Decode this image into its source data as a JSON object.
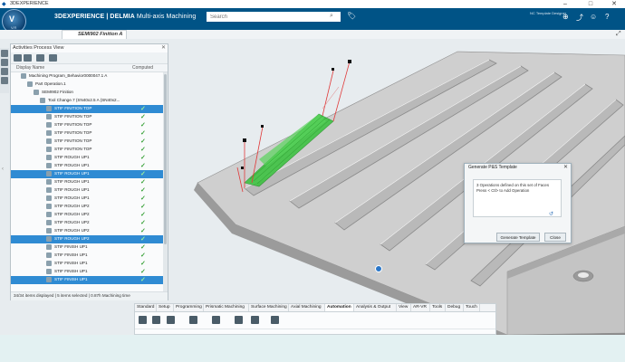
{
  "window": {
    "title": "3DEXPERIENCE",
    "controls": [
      "–",
      "□",
      "✕"
    ]
  },
  "header": {
    "brand_prefix": "3D",
    "brand_main": "EXPERIENCE | DELMIA",
    "app_name": " Multi-axis Machining",
    "search_placeholder": "Search",
    "user": "NC Template Designer",
    "compass_version": "V.R",
    "icons": [
      "tag-icon",
      "add-icon",
      "share-icon",
      "person-icon",
      "help-icon"
    ]
  },
  "document_tab": {
    "label": "SEMI902 Finition A"
  },
  "panel": {
    "title": "Activities Process View",
    "close": "✕",
    "columns": {
      "name": "Display Name",
      "computed": "Computed"
    },
    "status": "34/34 items displayed | 5 items selected | 0.87h Machining time",
    "rows": [
      {
        "label": "Machining Program_Behavior0000047.1 A",
        "indent": 1,
        "selected": false,
        "computed": false
      },
      {
        "label": "Part Operation.1",
        "indent": 2,
        "selected": false,
        "computed": false
      },
      {
        "label": "SEMI902 Finition",
        "indent": 3,
        "selected": false,
        "computed": false
      },
      {
        "label": "Tool Change.7 (SN40x2.5 A (SN40x2...",
        "indent": 4,
        "selected": false,
        "computed": false
      },
      {
        "label": "STIF FINITION TOP",
        "indent": 5,
        "selected": true,
        "computed": true
      },
      {
        "label": "STIF FINITION TOP",
        "indent": 5,
        "selected": false,
        "computed": true
      },
      {
        "label": "STIF FINITION TOP",
        "indent": 5,
        "selected": false,
        "computed": true
      },
      {
        "label": "STIF FINITION TOP",
        "indent": 5,
        "selected": false,
        "computed": true
      },
      {
        "label": "STIF FINITION TOP",
        "indent": 5,
        "selected": false,
        "computed": true
      },
      {
        "label": "STIF FINITION TOP",
        "indent": 5,
        "selected": false,
        "computed": true
      },
      {
        "label": "STIF ROUGH UP1",
        "indent": 5,
        "selected": false,
        "computed": true
      },
      {
        "label": "STIF ROUGH UP1",
        "indent": 5,
        "selected": false,
        "computed": true
      },
      {
        "label": "STIF ROUGH UP1",
        "indent": 5,
        "selected": true,
        "computed": true
      },
      {
        "label": "STIF ROUGH UP1",
        "indent": 5,
        "selected": false,
        "computed": true
      },
      {
        "label": "STIF ROUGH UP1",
        "indent": 5,
        "selected": false,
        "computed": true
      },
      {
        "label": "STIF ROUGH UP1",
        "indent": 5,
        "selected": false,
        "computed": true
      },
      {
        "label": "STIF ROUGH UP2",
        "indent": 5,
        "selected": false,
        "computed": true
      },
      {
        "label": "STIF ROUGH UP2",
        "indent": 5,
        "selected": false,
        "computed": true
      },
      {
        "label": "STIF ROUGH UP2",
        "indent": 5,
        "selected": false,
        "computed": true
      },
      {
        "label": "STIF ROUGH UP2",
        "indent": 5,
        "selected": false,
        "computed": true
      },
      {
        "label": "STIF ROUGH UP2",
        "indent": 5,
        "selected": true,
        "computed": true
      },
      {
        "label": "STIF FINISH UP1",
        "indent": 5,
        "selected": false,
        "computed": true
      },
      {
        "label": "STIF FINISH UP1",
        "indent": 5,
        "selected": false,
        "computed": true
      },
      {
        "label": "STIF FINISH UP1",
        "indent": 5,
        "selected": false,
        "computed": true
      },
      {
        "label": "STIF FINISH UP1",
        "indent": 5,
        "selected": false,
        "computed": true
      },
      {
        "label": "STIF FINISH UP1",
        "indent": 5,
        "selected": true,
        "computed": true
      }
    ]
  },
  "dialog": {
    "title": "Generate P&S Template",
    "close": "✕",
    "message_line1": "3 Operations defined on this set of Faces",
    "message_line2": "Press < Ctl> to Add Operation",
    "generate_label": "Generate Template",
    "close_label": "Close"
  },
  "action_bar": {
    "tabs": [
      "Standard",
      "Setup",
      "Programming",
      "Prismatic Machining",
      "Surface Machining",
      "Axial Machining",
      "Automation",
      "Analysis & Output",
      "View",
      "AR-VR",
      "Tools",
      "Debug",
      "Touch"
    ],
    "active_tab": "Automation",
    "icons": [
      "cut-icon",
      "copy-icon",
      "paste-icon",
      "list-icon",
      "parameters-icon",
      "transfer-icon",
      "template-icon",
      "catalog-icon"
    ]
  },
  "colors": {
    "header_bg": "#005386",
    "selection": "#2f8bd3",
    "computed_check": "#3aa23a",
    "toolpath_green": "#36c23a",
    "tool_axis_red": "#e03a3a"
  }
}
